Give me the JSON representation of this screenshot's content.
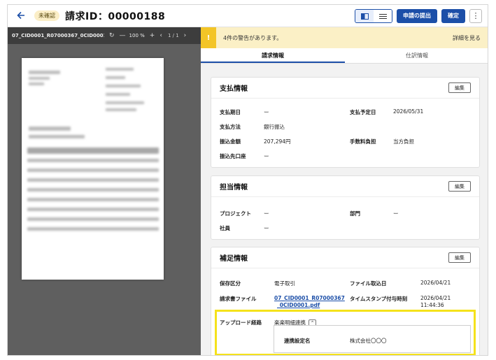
{
  "header": {
    "status": "未確認",
    "title": "請求ID：00000188",
    "submit_label": "申請の提出",
    "confirm_label": "確定",
    "more_icon": "⋮"
  },
  "pdf": {
    "filename": "07_CID0001_R07000367_0CID0001.···",
    "zoom": "100 %",
    "page": "1 / 1"
  },
  "warning": {
    "text": "4件の警告があります。",
    "link": "詳細を見る"
  },
  "tabs": [
    {
      "label": "請求情報"
    },
    {
      "label": "仕訳情報"
    }
  ],
  "payment": {
    "title": "支払情報",
    "edit": "編集",
    "due_date_label": "支払期日",
    "due_date": "ー",
    "scheduled_label": "支払予定日",
    "scheduled": "2026/05/31",
    "method_label": "支払方法",
    "method": "銀行振込",
    "amount_label": "振込金額",
    "amount": "207,294円",
    "fee_label": "手数料負担",
    "fee": "当方負担",
    "account_label": "振込先口座",
    "account": "ー"
  },
  "assignee": {
    "title": "担当情報",
    "edit": "編集",
    "project_label": "プロジェクト",
    "project": "ー",
    "dept_label": "部門",
    "dept": "ー",
    "employee_label": "社員",
    "employee": "ー"
  },
  "supplement": {
    "title": "補足情報",
    "edit": "編集",
    "storage_label": "保存区分",
    "storage": "電子取引",
    "import_date_label": "ファイル取込日",
    "import_date": "2026/04/21",
    "file_label": "請求書ファイル",
    "file_line1": "07_CID0001_R07000367",
    "file_line2": "_0CID0001.pdf",
    "timestamp_label": "タイムスタンプ付与時刻",
    "timestamp_date": "2026/04/21",
    "timestamp_time": "11:44:36",
    "upload_route_label": "アップロード経路",
    "upload_route": "楽楽明細連携",
    "link_setting_label": "連携設定名",
    "link_setting": "株式会社〇〇〇"
  },
  "colors": {
    "primary": "#1c4fa8",
    "warning_bg": "#fbf0c6",
    "warning_icon": "#f3c527",
    "highlight": "#f5e21b"
  }
}
